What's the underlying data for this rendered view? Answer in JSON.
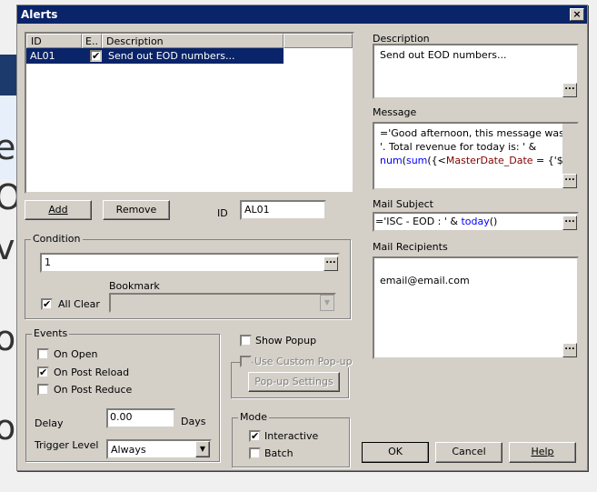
{
  "background": {
    "fragments": [
      "e",
      "Or",
      "v",
      "o",
      "o"
    ]
  },
  "dialog": {
    "title": "Alerts",
    "close": "×"
  },
  "list": {
    "columns": [
      "ID",
      "E..",
      "Description"
    ],
    "rows": [
      {
        "id": "AL01",
        "enabled": true,
        "description": "Send out EOD numbers..."
      }
    ]
  },
  "buttons": {
    "add": "Add",
    "remove": "Remove",
    "ok": "OK",
    "cancel": "Cancel",
    "help": "Help",
    "popup_settings": "Pop-up Settings",
    "ellipsis": "..."
  },
  "id_field": {
    "label": "ID",
    "value": "AL01"
  },
  "condition": {
    "label": "Condition",
    "value": "1",
    "all_clear": "All Clear",
    "all_clear_checked": true,
    "bookmark_label": "Bookmark",
    "bookmark_value": ""
  },
  "events": {
    "label": "Events",
    "on_open": "On Open",
    "on_post_reload": "On Post Reload",
    "on_post_reduce": "On Post Reduce",
    "checked": {
      "on_open": false,
      "on_post_reload": true,
      "on_post_reduce": false
    },
    "delay_label": "Delay",
    "delay_value": "0.00",
    "days": "Days",
    "trigger_label": "Trigger Level",
    "trigger_value": "Always"
  },
  "popup": {
    "show_popup": "Show Popup",
    "use_custom": "Use Custom Pop-up"
  },
  "mode": {
    "label": "Mode",
    "interactive": "Interactive",
    "batch": "Batch",
    "interactive_checked": true,
    "batch_checked": false
  },
  "description": {
    "label": "Description",
    "value": "Send out EOD numbers..."
  },
  "message": {
    "label": "Message",
    "line1": "='Good afternoon, this message was",
    "line2": "'. Total revenue for today is: ' &",
    "line3_fn1": "num",
    "line3_p1": "(",
    "line3_fn2": "sum",
    "line3_p2": "({<",
    "line3_field": "MasterDate_Date",
    "line3_rest": " = {'$(V"
  },
  "mail_subject": {
    "label": "Mail Subject",
    "prefix": "='ISC - EOD : ' & ",
    "fn": "today",
    "suffix": "()"
  },
  "mail_recipients": {
    "label": "Mail Recipients",
    "value": "email@email.com"
  }
}
